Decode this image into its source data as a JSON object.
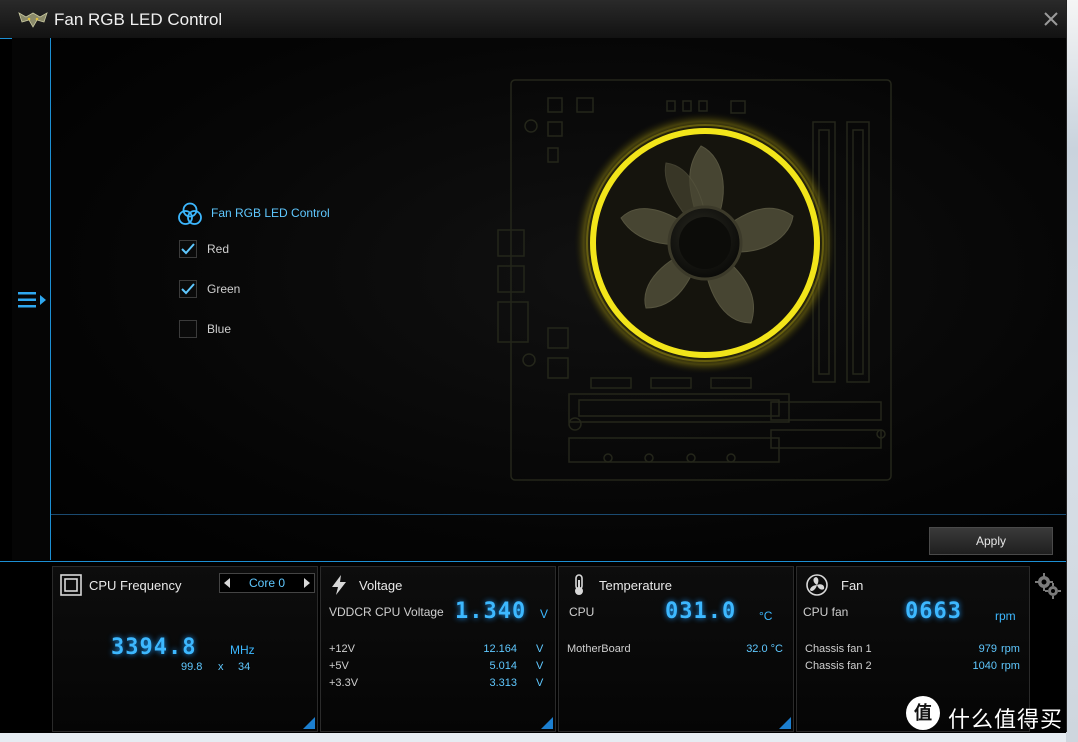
{
  "window": {
    "title": "Fan RGB LED Control"
  },
  "control": {
    "title": "Fan RGB LED Control",
    "options": [
      {
        "label": "Red",
        "checked": true
      },
      {
        "label": "Green",
        "checked": true
      },
      {
        "label": "Blue",
        "checked": false
      }
    ],
    "apply_label": "Apply"
  },
  "accent_colors": {
    "blue": "#3db8ff",
    "fan_ring": "#f2e51a"
  },
  "monitor": {
    "cpu": {
      "title": "CPU Frequency",
      "core_selector": "Core 0",
      "frequency": "3394.8",
      "unit": "MHz",
      "multiplier_base": "99.8",
      "multiplier_x": "x",
      "multiplier_ratio": "34"
    },
    "voltage": {
      "title": "Voltage",
      "main_label": "VDDCR CPU Voltage",
      "main_value": "1.340",
      "main_unit": "V",
      "rows": [
        {
          "label": "+12V",
          "value": "12.164",
          "unit": "V"
        },
        {
          "label": "+5V",
          "value": "5.014",
          "unit": "V"
        },
        {
          "label": "+3.3V",
          "value": "3.313",
          "unit": "V"
        }
      ]
    },
    "temperature": {
      "title": "Temperature",
      "main_label": "CPU",
      "main_value": "031.0",
      "main_unit": "°C",
      "rows": [
        {
          "label": "MotherBoard",
          "value": "32.0 °C"
        }
      ]
    },
    "fan": {
      "title": "Fan",
      "main_label": "CPU fan",
      "main_value": "0663",
      "main_unit": "rpm",
      "rows": [
        {
          "label": "Chassis fan 1",
          "value": "979",
          "unit": "rpm"
        },
        {
          "label": "Chassis fan 2",
          "value": "1040",
          "unit": "rpm"
        }
      ]
    }
  },
  "watermark": {
    "badge": "值",
    "text": "什么值得买"
  }
}
